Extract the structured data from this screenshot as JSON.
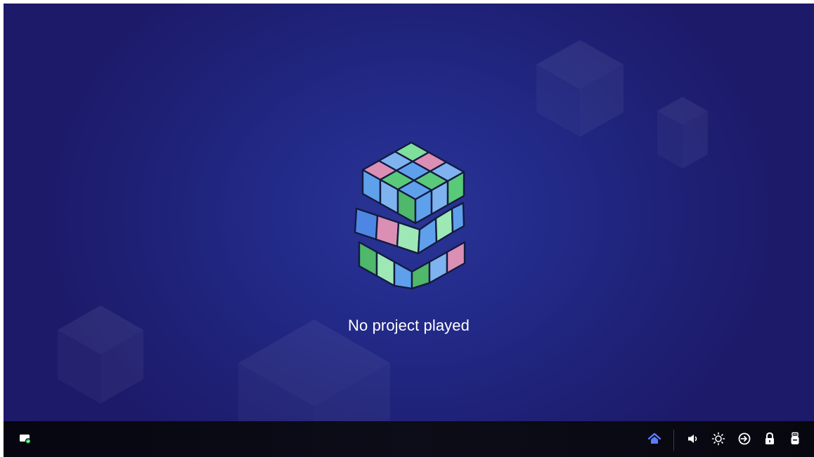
{
  "main": {
    "message": "No project played",
    "illustration": "rubiks-cube"
  },
  "taskbar": {
    "left_icon": "screen-connected-icon",
    "right_icons": [
      "home-icon",
      "volume-icon",
      "brightness-icon",
      "input-source-icon",
      "lock-icon",
      "usb-icon"
    ],
    "home_active": true
  },
  "colors": {
    "background": "#1f237a",
    "taskbar": "#0a0b14",
    "accent_home": "#5b7cff",
    "status_green": "#34c759"
  }
}
